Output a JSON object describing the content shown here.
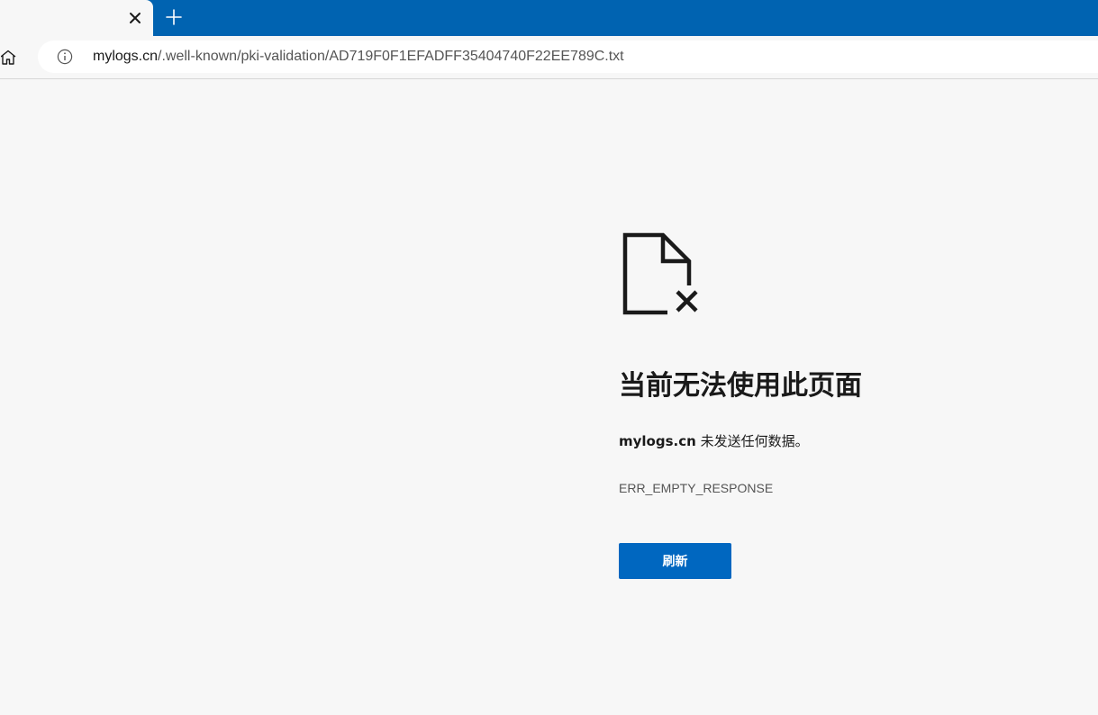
{
  "colors": {
    "tabstrip": "#0063b1",
    "page_background": "#f7f7f7",
    "primary_button": "#0067c0",
    "text_primary": "#1a1a1a",
    "text_secondary": "#555555"
  },
  "tabs": {
    "close_icon": "close-icon",
    "new_tab_icon": "plus-icon"
  },
  "toolbar": {
    "home_icon": "home-icon",
    "info_icon": "info-icon",
    "url_host": "mylogs.cn",
    "url_path": "/.well-known/pki-validation/AD719F0F1EFADFF35404740F22EE789C.txt"
  },
  "error": {
    "icon": "broken-file-icon",
    "title": "当前无法使用此页面",
    "message_host": "mylogs.cn",
    "message_text": " 未发送任何数据。",
    "code": "ERR_EMPTY_RESPONSE",
    "refresh_label": "刷新"
  }
}
